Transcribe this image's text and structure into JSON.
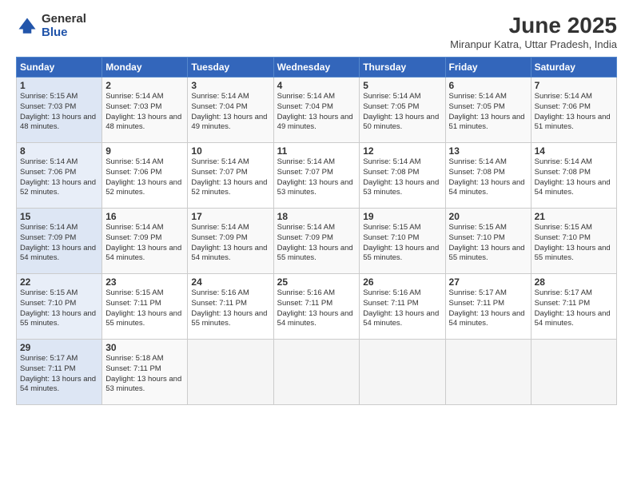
{
  "logo": {
    "general": "General",
    "blue": "Blue"
  },
  "title": "June 2025",
  "subtitle": "Miranpur Katra, Uttar Pradesh, India",
  "days_of_week": [
    "Sunday",
    "Monday",
    "Tuesday",
    "Wednesday",
    "Thursday",
    "Friday",
    "Saturday"
  ],
  "weeks": [
    [
      {
        "day": "1",
        "sunrise": "Sunrise: 5:15 AM",
        "sunset": "Sunset: 7:03 PM",
        "daylight": "Daylight: 13 hours and 48 minutes."
      },
      {
        "day": "2",
        "sunrise": "Sunrise: 5:14 AM",
        "sunset": "Sunset: 7:03 PM",
        "daylight": "Daylight: 13 hours and 48 minutes."
      },
      {
        "day": "3",
        "sunrise": "Sunrise: 5:14 AM",
        "sunset": "Sunset: 7:04 PM",
        "daylight": "Daylight: 13 hours and 49 minutes."
      },
      {
        "day": "4",
        "sunrise": "Sunrise: 5:14 AM",
        "sunset": "Sunset: 7:04 PM",
        "daylight": "Daylight: 13 hours and 49 minutes."
      },
      {
        "day": "5",
        "sunrise": "Sunrise: 5:14 AM",
        "sunset": "Sunset: 7:05 PM",
        "daylight": "Daylight: 13 hours and 50 minutes."
      },
      {
        "day": "6",
        "sunrise": "Sunrise: 5:14 AM",
        "sunset": "Sunset: 7:05 PM",
        "daylight": "Daylight: 13 hours and 51 minutes."
      },
      {
        "day": "7",
        "sunrise": "Sunrise: 5:14 AM",
        "sunset": "Sunset: 7:06 PM",
        "daylight": "Daylight: 13 hours and 51 minutes."
      }
    ],
    [
      {
        "day": "8",
        "sunrise": "Sunrise: 5:14 AM",
        "sunset": "Sunset: 7:06 PM",
        "daylight": "Daylight: 13 hours and 52 minutes."
      },
      {
        "day": "9",
        "sunrise": "Sunrise: 5:14 AM",
        "sunset": "Sunset: 7:06 PM",
        "daylight": "Daylight: 13 hours and 52 minutes."
      },
      {
        "day": "10",
        "sunrise": "Sunrise: 5:14 AM",
        "sunset": "Sunset: 7:07 PM",
        "daylight": "Daylight: 13 hours and 52 minutes."
      },
      {
        "day": "11",
        "sunrise": "Sunrise: 5:14 AM",
        "sunset": "Sunset: 7:07 PM",
        "daylight": "Daylight: 13 hours and 53 minutes."
      },
      {
        "day": "12",
        "sunrise": "Sunrise: 5:14 AM",
        "sunset": "Sunset: 7:08 PM",
        "daylight": "Daylight: 13 hours and 53 minutes."
      },
      {
        "day": "13",
        "sunrise": "Sunrise: 5:14 AM",
        "sunset": "Sunset: 7:08 PM",
        "daylight": "Daylight: 13 hours and 54 minutes."
      },
      {
        "day": "14",
        "sunrise": "Sunrise: 5:14 AM",
        "sunset": "Sunset: 7:08 PM",
        "daylight": "Daylight: 13 hours and 54 minutes."
      }
    ],
    [
      {
        "day": "15",
        "sunrise": "Sunrise: 5:14 AM",
        "sunset": "Sunset: 7:09 PM",
        "daylight": "Daylight: 13 hours and 54 minutes."
      },
      {
        "day": "16",
        "sunrise": "Sunrise: 5:14 AM",
        "sunset": "Sunset: 7:09 PM",
        "daylight": "Daylight: 13 hours and 54 minutes."
      },
      {
        "day": "17",
        "sunrise": "Sunrise: 5:14 AM",
        "sunset": "Sunset: 7:09 PM",
        "daylight": "Daylight: 13 hours and 54 minutes."
      },
      {
        "day": "18",
        "sunrise": "Sunrise: 5:14 AM",
        "sunset": "Sunset: 7:09 PM",
        "daylight": "Daylight: 13 hours and 55 minutes."
      },
      {
        "day": "19",
        "sunrise": "Sunrise: 5:15 AM",
        "sunset": "Sunset: 7:10 PM",
        "daylight": "Daylight: 13 hours and 55 minutes."
      },
      {
        "day": "20",
        "sunrise": "Sunrise: 5:15 AM",
        "sunset": "Sunset: 7:10 PM",
        "daylight": "Daylight: 13 hours and 55 minutes."
      },
      {
        "day": "21",
        "sunrise": "Sunrise: 5:15 AM",
        "sunset": "Sunset: 7:10 PM",
        "daylight": "Daylight: 13 hours and 55 minutes."
      }
    ],
    [
      {
        "day": "22",
        "sunrise": "Sunrise: 5:15 AM",
        "sunset": "Sunset: 7:10 PM",
        "daylight": "Daylight: 13 hours and 55 minutes."
      },
      {
        "day": "23",
        "sunrise": "Sunrise: 5:15 AM",
        "sunset": "Sunset: 7:11 PM",
        "daylight": "Daylight: 13 hours and 55 minutes."
      },
      {
        "day": "24",
        "sunrise": "Sunrise: 5:16 AM",
        "sunset": "Sunset: 7:11 PM",
        "daylight": "Daylight: 13 hours and 55 minutes."
      },
      {
        "day": "25",
        "sunrise": "Sunrise: 5:16 AM",
        "sunset": "Sunset: 7:11 PM",
        "daylight": "Daylight: 13 hours and 54 minutes."
      },
      {
        "day": "26",
        "sunrise": "Sunrise: 5:16 AM",
        "sunset": "Sunset: 7:11 PM",
        "daylight": "Daylight: 13 hours and 54 minutes."
      },
      {
        "day": "27",
        "sunrise": "Sunrise: 5:17 AM",
        "sunset": "Sunset: 7:11 PM",
        "daylight": "Daylight: 13 hours and 54 minutes."
      },
      {
        "day": "28",
        "sunrise": "Sunrise: 5:17 AM",
        "sunset": "Sunset: 7:11 PM",
        "daylight": "Daylight: 13 hours and 54 minutes."
      }
    ],
    [
      {
        "day": "29",
        "sunrise": "Sunrise: 5:17 AM",
        "sunset": "Sunset: 7:11 PM",
        "daylight": "Daylight: 13 hours and 54 minutes."
      },
      {
        "day": "30",
        "sunrise": "Sunrise: 5:18 AM",
        "sunset": "Sunset: 7:11 PM",
        "daylight": "Daylight: 13 hours and 53 minutes."
      },
      null,
      null,
      null,
      null,
      null
    ]
  ]
}
